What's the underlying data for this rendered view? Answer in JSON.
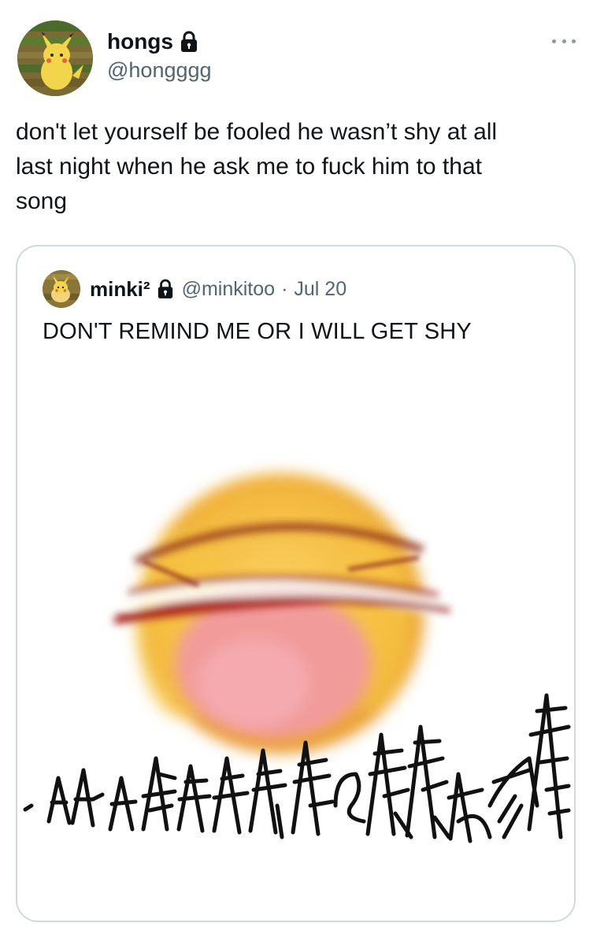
{
  "tweet": {
    "author": {
      "display_name": "hongs",
      "handle": "@hongggg",
      "avatar_icon": "pikachu-avatar",
      "locked": true
    },
    "text": "don't let yourself be fooled he wasn’t shy at all\nlast night when he ask me to fuck him to that\nsong",
    "more_icon": "more-icon"
  },
  "quoted_tweet": {
    "author": {
      "display_name": "minki²",
      "handle": "@minkitoo",
      "avatar_icon": "pikachu-avatar",
      "locked": true
    },
    "meta_separator": "·",
    "date": "Jul 20",
    "text": "DON'T REMIND ME OR I WILL GET SHY",
    "image": {
      "description_icon": "blushing-emoji-image",
      "scribble_text": "AAAAAAAAAAAA"
    }
  },
  "colors": {
    "text": "#0f1419",
    "secondary": "#536471",
    "border": "#cfd9de",
    "emoji_yellow": "#f6c445",
    "blush": "#f19a9f",
    "eye_red": "#a8281f"
  }
}
